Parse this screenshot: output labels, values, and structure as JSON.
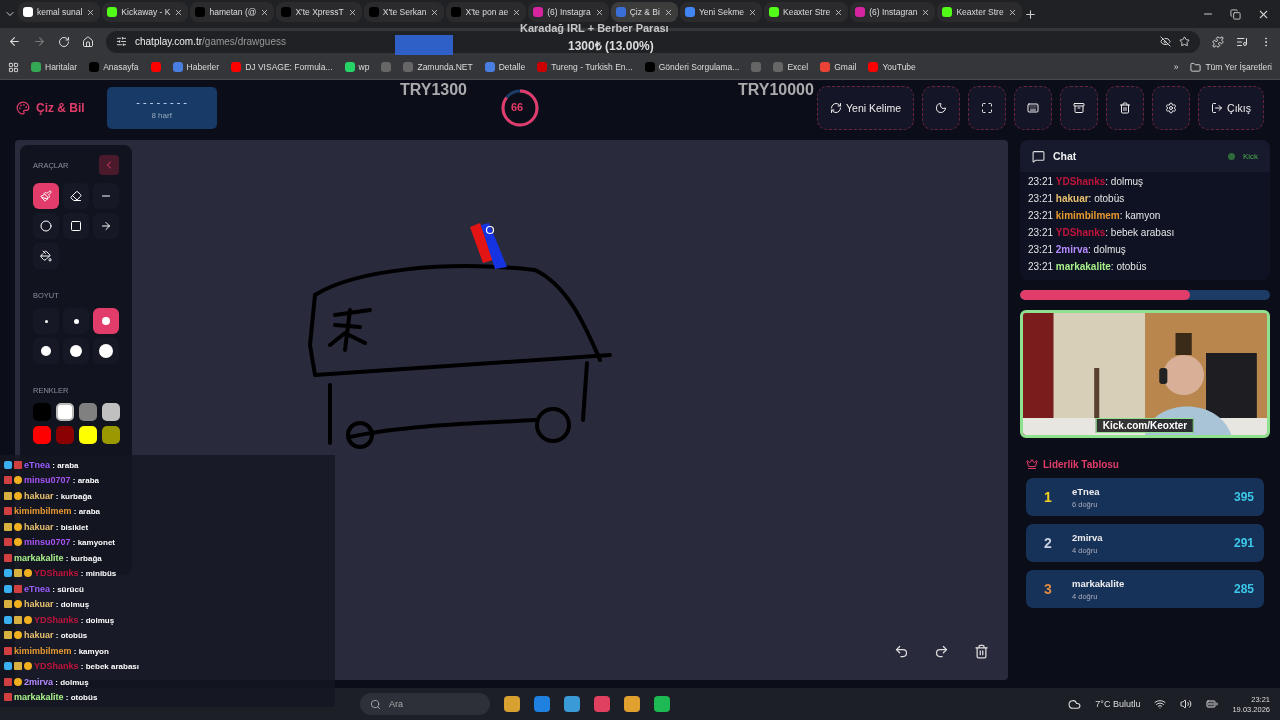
{
  "browser": {
    "tabs": [
      {
        "title": "kemal sunal",
        "kind": "google",
        "selected": false
      },
      {
        "title": "Kickaway - K",
        "kind": "kick",
        "selected": false
      },
      {
        "title": "hametan (@",
        "kind": "x",
        "selected": false
      },
      {
        "title": "X'te XpressT",
        "kind": "x",
        "selected": false
      },
      {
        "title": "X'te Serkan",
        "kind": "x",
        "selected": false
      },
      {
        "title": "X'te pon ae",
        "kind": "x",
        "selected": false
      },
      {
        "title": "(6) Instagra",
        "kind": "instagram",
        "selected": false
      },
      {
        "title": "Çiz & Bi",
        "kind": "chatplay",
        "selected": true
      },
      {
        "title": "Yeni Sekme",
        "kind": "chrome",
        "selected": false
      },
      {
        "title": "Keaxter Stre",
        "kind": "kick",
        "selected": false
      },
      {
        "title": "(6) Instagran",
        "kind": "instagram",
        "selected": false
      },
      {
        "title": "Keaxter Stre",
        "kind": "kick",
        "selected": false
      }
    ],
    "url_host": "chatplay.com.tr",
    "url_path": "/games/drawguess",
    "bookmarks": [
      {
        "label": "Haritalar",
        "kind": "maps"
      },
      {
        "label": "Anasayfa",
        "kind": "x"
      },
      {
        "kind": "youtube"
      },
      {
        "label": "Haberler",
        "kind": "news"
      },
      {
        "label": "DJ VISAGE: Formula...",
        "kind": "youtube"
      },
      {
        "label": "wp",
        "kind": "whatsapp"
      },
      {
        "kind": "globe"
      },
      {
        "label": "Zamunda.NET",
        "kind": "globe"
      },
      {
        "label": "Detalle",
        "kind": "news"
      },
      {
        "label": "Tureng - Turkish En...",
        "kind": "tureng"
      },
      {
        "label": "Gönderi Sorgulama...",
        "kind": "x"
      },
      {
        "kind": "globe"
      },
      {
        "label": "Excel",
        "kind": "globe"
      },
      {
        "label": "Gmail",
        "kind": "gmail"
      },
      {
        "label": "YouTube",
        "kind": "youtube"
      }
    ],
    "overflow": "»",
    "all_bookmarks": "Tüm Yer İşaretleri"
  },
  "stream_overlay": {
    "title": "Karadağ IRL + Berber Parası",
    "goal": "1300₺ (13.00%)",
    "donations": [
      "TRY1300",
      "TRY10000"
    ]
  },
  "app": {
    "logo": "Çiz & Bil",
    "hint": {
      "mask": "- - - - - - - -",
      "letters": "8 harf"
    },
    "timer": {
      "value": "66"
    },
    "actions": [
      {
        "kind": "new",
        "label": "Yeni Kelime"
      },
      {
        "kind": "theme"
      },
      {
        "kind": "fullscreen"
      },
      {
        "kind": "keyboard"
      },
      {
        "kind": "archive"
      },
      {
        "kind": "trash"
      },
      {
        "kind": "settings"
      },
      {
        "kind": "exit",
        "label": "Çıkış"
      }
    ]
  },
  "tools": {
    "title": "ARAÇLAR",
    "items": [
      {
        "kind": "brush",
        "selected": true
      },
      {
        "kind": "eraser",
        "selected": false
      },
      {
        "kind": "line",
        "selected": false
      },
      {
        "kind": "circle",
        "selected": false
      },
      {
        "kind": "square",
        "selected": false
      },
      {
        "kind": "arrow",
        "selected": false
      },
      {
        "kind": "fill",
        "selected": false
      }
    ],
    "size_title": "BOYUT",
    "sizes": [
      {
        "selected": false
      },
      {
        "selected": false
      },
      {
        "selected": true
      },
      {
        "selected": false
      },
      {
        "selected": false
      },
      {
        "selected": false
      }
    ],
    "colors_title": "RENKLER",
    "colors": [
      {
        "color": "#000000",
        "selected": false
      },
      {
        "color": "#ffffff",
        "selected": true
      },
      {
        "color": "#808080",
        "selected": false
      },
      {
        "color": "#c0c0c0",
        "selected": false
      },
      {
        "color": "#ff0000",
        "selected": false
      },
      {
        "color": "#8b0000",
        "selected": false
      },
      {
        "color": "#ffff00",
        "selected": false
      },
      {
        "color": "#9a9a00",
        "selected": false
      }
    ]
  },
  "canvas": {
    "controls": [
      {
        "kind": "undo"
      },
      {
        "kind": "redo"
      },
      {
        "kind": "clear"
      }
    ]
  },
  "stream_chat": [
    {
      "user": "eTnea",
      "color": "#9b5cff",
      "message": ": araba",
      "badges": [
        {
          "kind": "box"
        },
        {
          "kind": "sword"
        }
      ]
    },
    {
      "user": "minsu0707",
      "color": "#a855f7",
      "message": ": araba",
      "badges": [
        {
          "kind": "sword"
        },
        {
          "kind": "coin"
        }
      ]
    },
    {
      "user": "hakuar",
      "color": "#e8c170",
      "message": ": kurbağa",
      "badges": [
        {
          "kind": "crown"
        },
        {
          "kind": "coin"
        }
      ]
    },
    {
      "user": "kimimbilmem",
      "color": "#e89a30",
      "message": ": araba",
      "badges": [
        {
          "kind": "sword"
        }
      ]
    },
    {
      "user": "hakuar",
      "color": "#e8c170",
      "message": ": bisiklet",
      "badges": [
        {
          "kind": "crown"
        },
        {
          "kind": "coin"
        }
      ]
    },
    {
      "user": "minsu0707",
      "color": "#a855f7",
      "message": ": kamyonet",
      "badges": [
        {
          "kind": "sword"
        },
        {
          "kind": "coin"
        }
      ]
    },
    {
      "user": "markakalite",
      "color": "#a8f08a",
      "message": ": kurbağa",
      "badges": [
        {
          "kind": "sword"
        }
      ]
    },
    {
      "user": "YDShanks",
      "color": "#c0143c",
      "message": ": minibüs",
      "badges": [
        {
          "kind": "box"
        },
        {
          "kind": "crown"
        },
        {
          "kind": "coin"
        }
      ]
    },
    {
      "user": "eTnea",
      "color": "#9b5cff",
      "message": ": sürücü",
      "badges": [
        {
          "kind": "box"
        },
        {
          "kind": "sword"
        }
      ]
    },
    {
      "user": "hakuar",
      "color": "#e8c170",
      "message": ": dolmuş",
      "badges": [
        {
          "kind": "crown"
        },
        {
          "kind": "coin"
        }
      ]
    },
    {
      "user": "YDShanks",
      "color": "#c0143c",
      "message": ": dolmuş",
      "badges": [
        {
          "kind": "box"
        },
        {
          "kind": "crown"
        },
        {
          "kind": "coin"
        }
      ]
    },
    {
      "user": "hakuar",
      "color": "#e8c170",
      "message": ": otobüs",
      "badges": [
        {
          "kind": "crown"
        },
        {
          "kind": "coin"
        }
      ]
    },
    {
      "user": "kimimbilmem",
      "color": "#e89a30",
      "message": ": kamyon",
      "badges": [
        {
          "kind": "sword"
        }
      ]
    },
    {
      "user": "YDShanks",
      "color": "#c0143c",
      "message": ": bebek arabası",
      "badges": [
        {
          "kind": "box"
        },
        {
          "kind": "crown"
        },
        {
          "kind": "coin"
        }
      ]
    },
    {
      "user": "2mirva",
      "color": "#b58cff",
      "message": ": dolmuş",
      "badges": [
        {
          "kind": "sword"
        },
        {
          "kind": "coin"
        }
      ]
    },
    {
      "user": "markakalite",
      "color": "#a8f08a",
      "message": ": otobüs",
      "badges": [
        {
          "kind": "sword"
        }
      ]
    }
  ],
  "chat": {
    "title": "Chat",
    "source": "Kick",
    "level": 0.68,
    "messages": [
      {
        "time": "23:21",
        "user": "YDShanks",
        "color": "#c0143c",
        "message": ": dolmuş"
      },
      {
        "time": "23:21",
        "user": "hakuar",
        "color": "#e8c170",
        "message": ": otobüs"
      },
      {
        "time": "23:21",
        "user": "kimimbilmem",
        "color": "#e89a30",
        "message": ": kamyon"
      },
      {
        "time": "23:21",
        "user": "YDShanks",
        "color": "#c0143c",
        "message": ": bebek arabası"
      },
      {
        "time": "23:21",
        "user": "2mirva",
        "color": "#b58cff",
        "message": ": dolmuş"
      },
      {
        "time": "23:21",
        "user": "markakalite",
        "color": "#a8f08a",
        "message": ": otobüs"
      }
    ]
  },
  "webcam": {
    "kind": "picture",
    "caption": "Kick.com/Keoxter"
  },
  "leaderboard": {
    "title": "Liderlik Tablosu",
    "rows": [
      {
        "rank": "1",
        "name": "eTnea",
        "correct": "6 doğru",
        "score": "395"
      },
      {
        "rank": "2",
        "name": "2mirva",
        "correct": "4 doğru",
        "score": "291"
      },
      {
        "rank": "3",
        "name": "markakalite",
        "correct": "4 doğru",
        "score": "285"
      }
    ]
  },
  "taskbar": {
    "search": "Ara",
    "weather": "7°C Bulutlu",
    "time": "23:21",
    "date": "19.03.2026"
  }
}
